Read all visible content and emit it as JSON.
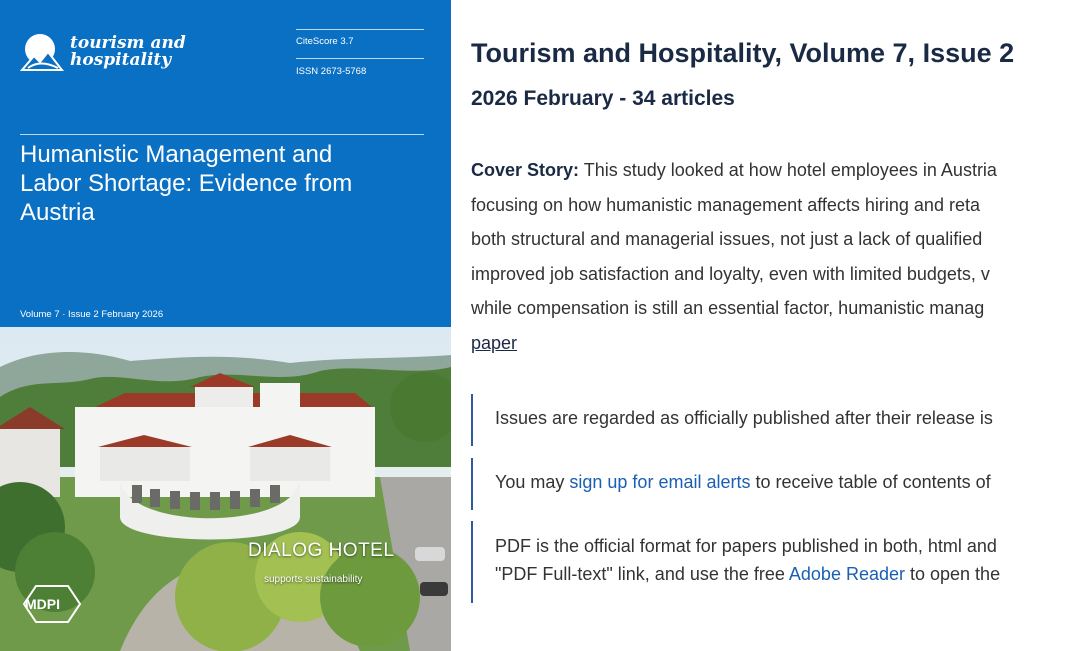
{
  "cover": {
    "journal_name_line1": "tourism and",
    "journal_name_line2": "hospitality",
    "citescore": "CiteScore 3.7",
    "issn": "ISSN 2673-5768",
    "cover_title_line1": "Humanistic Management and",
    "cover_title_line2": "Labor Shortage: Evidence from",
    "cover_title_line3": "Austria",
    "volume_line": "Volume 7 · Issue 2 February 2026",
    "hotel_name": "DIALOG HOTEL",
    "hotel_tagline": "supports sustainability",
    "publisher_logo": "MDPI",
    "accent_color": "#0a70c4"
  },
  "issue": {
    "title": "Tourism and Hospitality, Volume 7, Issue 2",
    "subtitle": "2026 February - 34 articles"
  },
  "cover_story": {
    "label": "Cover Story:",
    "line1": "This study looked at how hotel employees in Austria",
    "line2": "focusing on how humanistic management affects hiring and reta",
    "line3": "both structural and managerial issues, not just a lack of qualified",
    "line4": "improved job satisfaction and loyalty, even with limited budgets, v",
    "line5": "while compensation is still an essential factor, humanistic manag",
    "link_text": "paper"
  },
  "notices": {
    "n1": "Issues are regarded as officially published after their release is",
    "n2_prefix": "You may ",
    "n2_link": "sign up for email alerts",
    "n2_suffix": " to receive table of contents of",
    "n3_line1": "PDF is the official format for papers published in both, html and",
    "n3_line2_prefix": "\"PDF Full-text\" link, and use the free ",
    "n3_link": "Adobe Reader",
    "n3_line2_suffix": " to open the"
  }
}
